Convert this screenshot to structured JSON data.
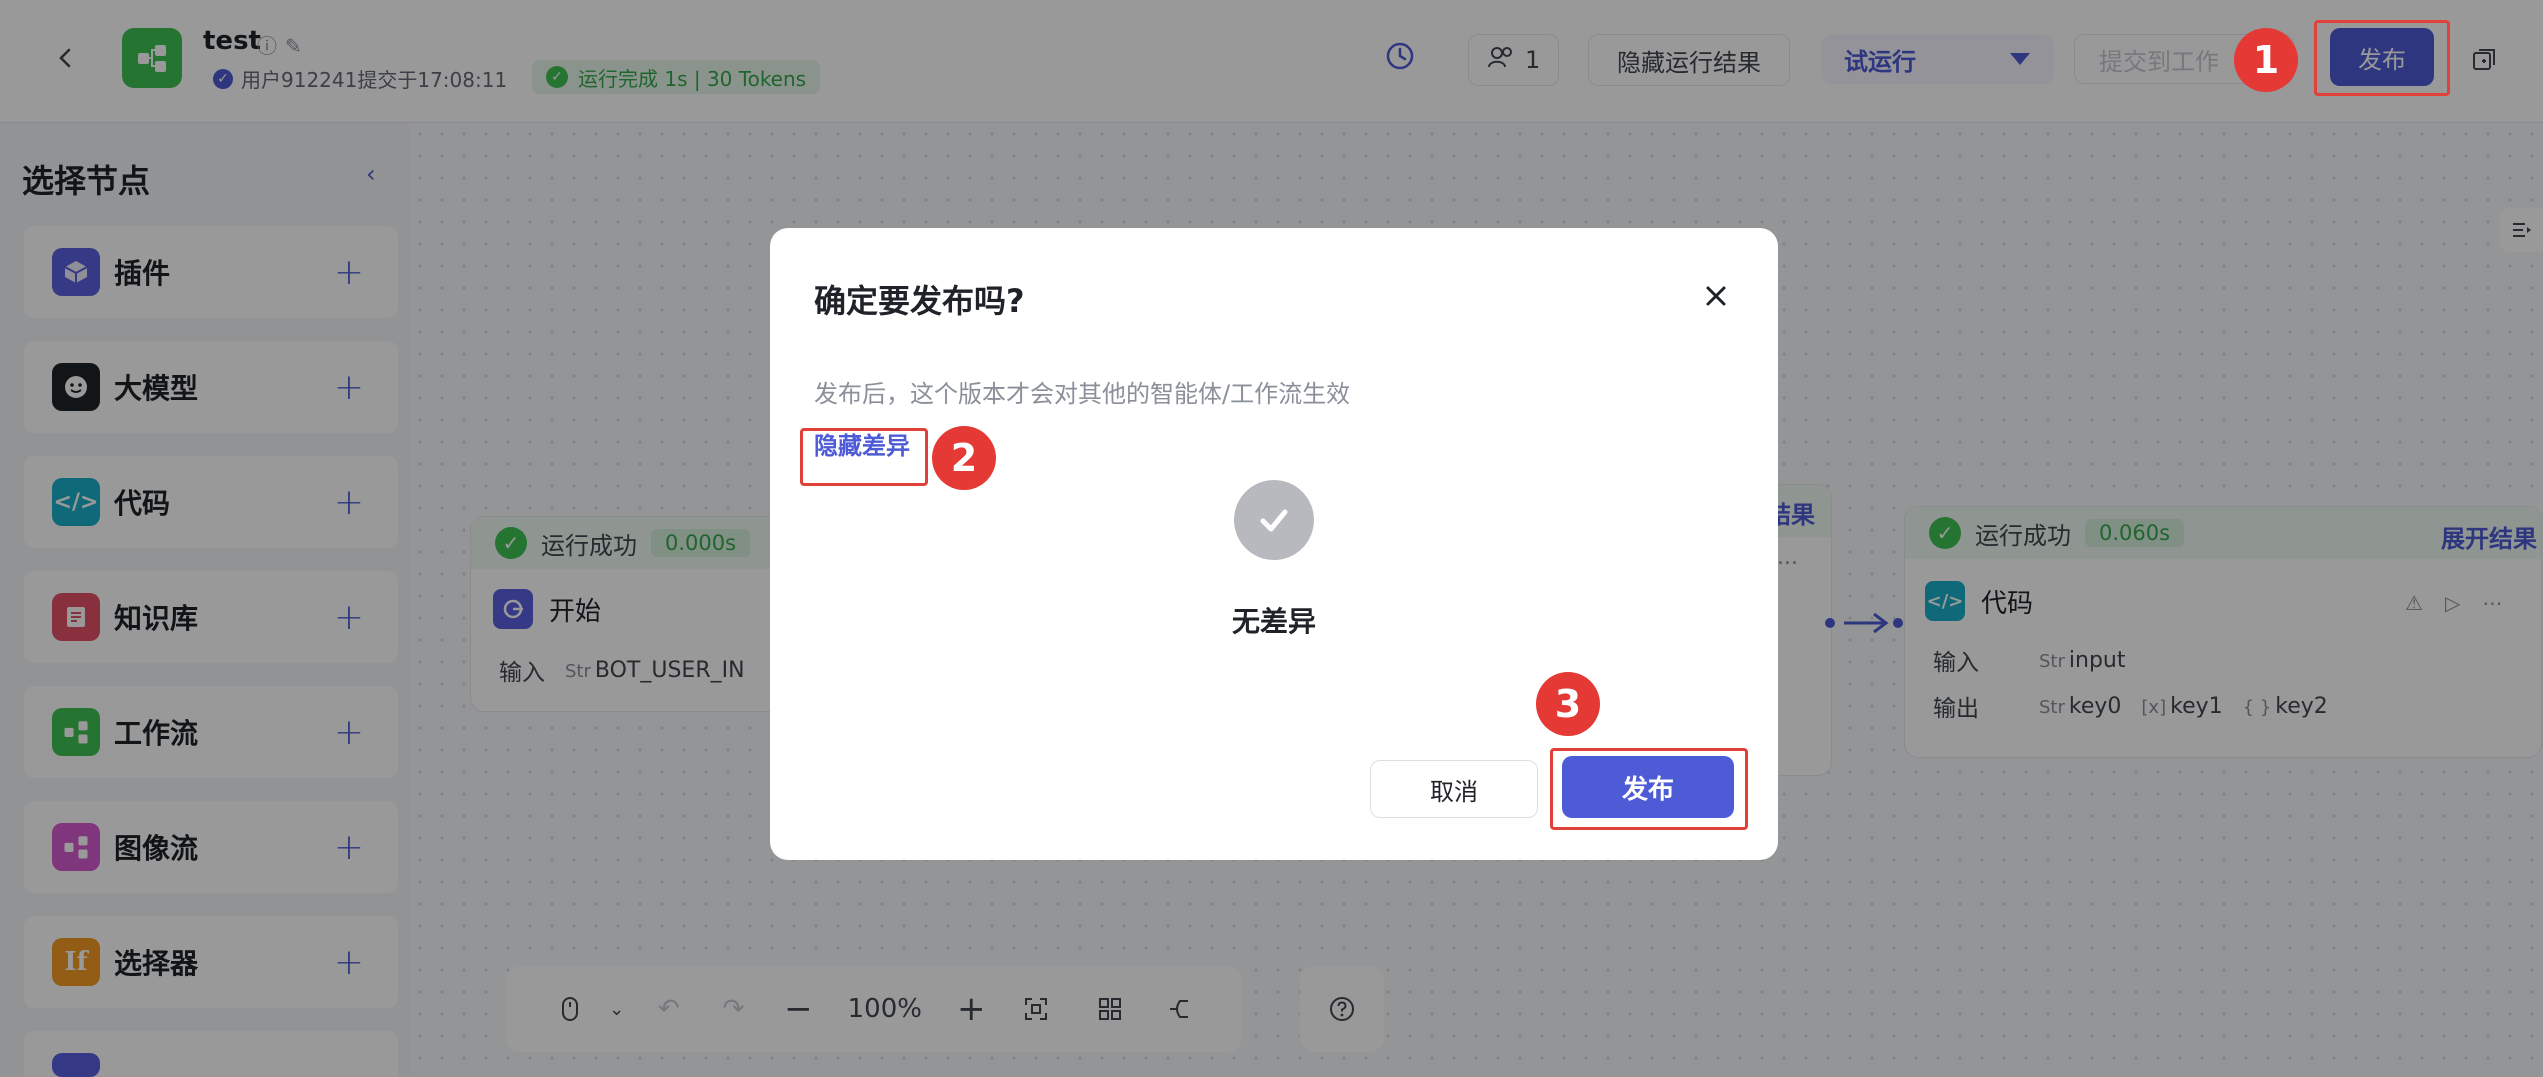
{
  "header": {
    "title": "test",
    "submit_info": "用户912241提交于17:08:11",
    "run_status": "运行完成 1s | 30 Tokens",
    "collaborator_count": "1",
    "hide_results_label": "隐藏运行结果",
    "trial_run_label": "试运行",
    "faded_button_label": "提交到工作",
    "publish_label": "发布"
  },
  "sidebar": {
    "title": "选择节点",
    "items": [
      {
        "label": "插件",
        "icon": "plugin-icon",
        "color": "#5b5fe0"
      },
      {
        "label": "大模型",
        "icon": "llm-icon",
        "color": "#1f2329"
      },
      {
        "label": "代码",
        "icon": "code-icon",
        "color": "#1ab0c8"
      },
      {
        "label": "知识库",
        "icon": "knowledge-icon",
        "color": "#e5506a"
      },
      {
        "label": "工作流",
        "icon": "workflow-icon",
        "color": "#3ec254"
      },
      {
        "label": "图像流",
        "icon": "imageflow-icon",
        "color": "#d65bd0"
      },
      {
        "label": "选择器",
        "icon": "selector-icon",
        "color": "#f59a23"
      }
    ]
  },
  "canvas": {
    "start_node": {
      "status": "运行成功",
      "time": "0.000s",
      "title": "开始",
      "input_label": "输入",
      "input_type": "Str",
      "input_value": "BOT_USER_IN"
    },
    "middle_node": {
      "expand_label": "结果",
      "ellipsis": "..."
    },
    "code_node": {
      "status": "运行成功",
      "time": "0.060s",
      "expand_label": "展开结果",
      "title": "代码",
      "input_label": "输入",
      "input_type": "Str",
      "input_value": "input",
      "output_label": "输出",
      "outputs": [
        {
          "type": "Str",
          "name": "key0"
        },
        {
          "type": "[x]",
          "name": "key1"
        },
        {
          "type": "{ }",
          "name": "key2"
        }
      ]
    }
  },
  "toolbar": {
    "zoom": "100%"
  },
  "modal": {
    "title": "确定要发布吗?",
    "description": "发布后，这个版本才会对其他的智能体/工作流生效",
    "hide_diff_label": "隐藏差异",
    "no_diff_label": "无差异",
    "cancel_label": "取消",
    "confirm_label": "发布"
  },
  "annotations": [
    "1",
    "2",
    "3"
  ],
  "colors": {
    "accent": "#4e5bd6",
    "success": "#3ec254",
    "annotation_red": "#e53935"
  }
}
